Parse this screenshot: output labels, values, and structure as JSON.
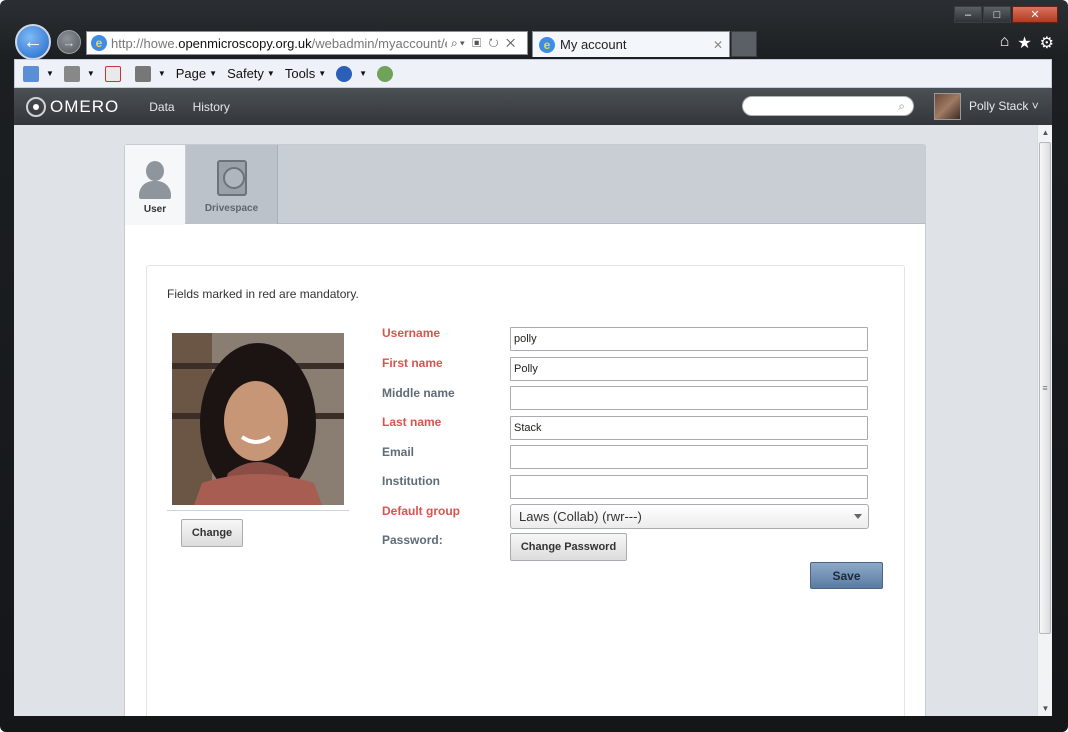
{
  "browser": {
    "url_prefix": "http://howe.",
    "url_domain": "openmicroscopy.org.uk",
    "url_path": "/webadmin/myaccount/e",
    "tab_title": "My account",
    "window_controls": [
      "–",
      "□",
      "✕"
    ],
    "right_icons": [
      "⌂",
      "★",
      "⚙"
    ]
  },
  "command_bar": {
    "items": [
      "Page",
      "Safety",
      "Tools"
    ]
  },
  "app": {
    "logo": "OMERO",
    "nav": [
      "Data",
      "History"
    ],
    "search_placeholder": "",
    "user_name": "Polly Stack"
  },
  "account_tabs": [
    {
      "label": "User",
      "icon": "person-icon",
      "active": true
    },
    {
      "label": "Drivespace",
      "icon": "disk-icon",
      "active": false
    }
  ],
  "form": {
    "note": "Fields marked in red are mandatory.",
    "change_photo_label": "Change",
    "fields": [
      {
        "label": "Username",
        "value": "polly",
        "required": true
      },
      {
        "label": "First name",
        "value": "Polly",
        "required": true
      },
      {
        "label": "Middle name",
        "value": "",
        "required": false
      },
      {
        "label": "Last name",
        "value": "Stack",
        "required": true
      },
      {
        "label": "Email",
        "value": "",
        "required": false
      },
      {
        "label": "Institution",
        "value": "",
        "required": false
      }
    ],
    "default_group_label": "Default group",
    "default_group_value": "Laws (Collab) (rwr---)",
    "password_label": "Password:",
    "change_password_label": "Change Password",
    "save_label": "Save"
  },
  "colors": {
    "required_label": "#d9534f",
    "label": "#5e6c78",
    "header_bar": "#3f4347",
    "save_button": "#6f8fb3"
  }
}
